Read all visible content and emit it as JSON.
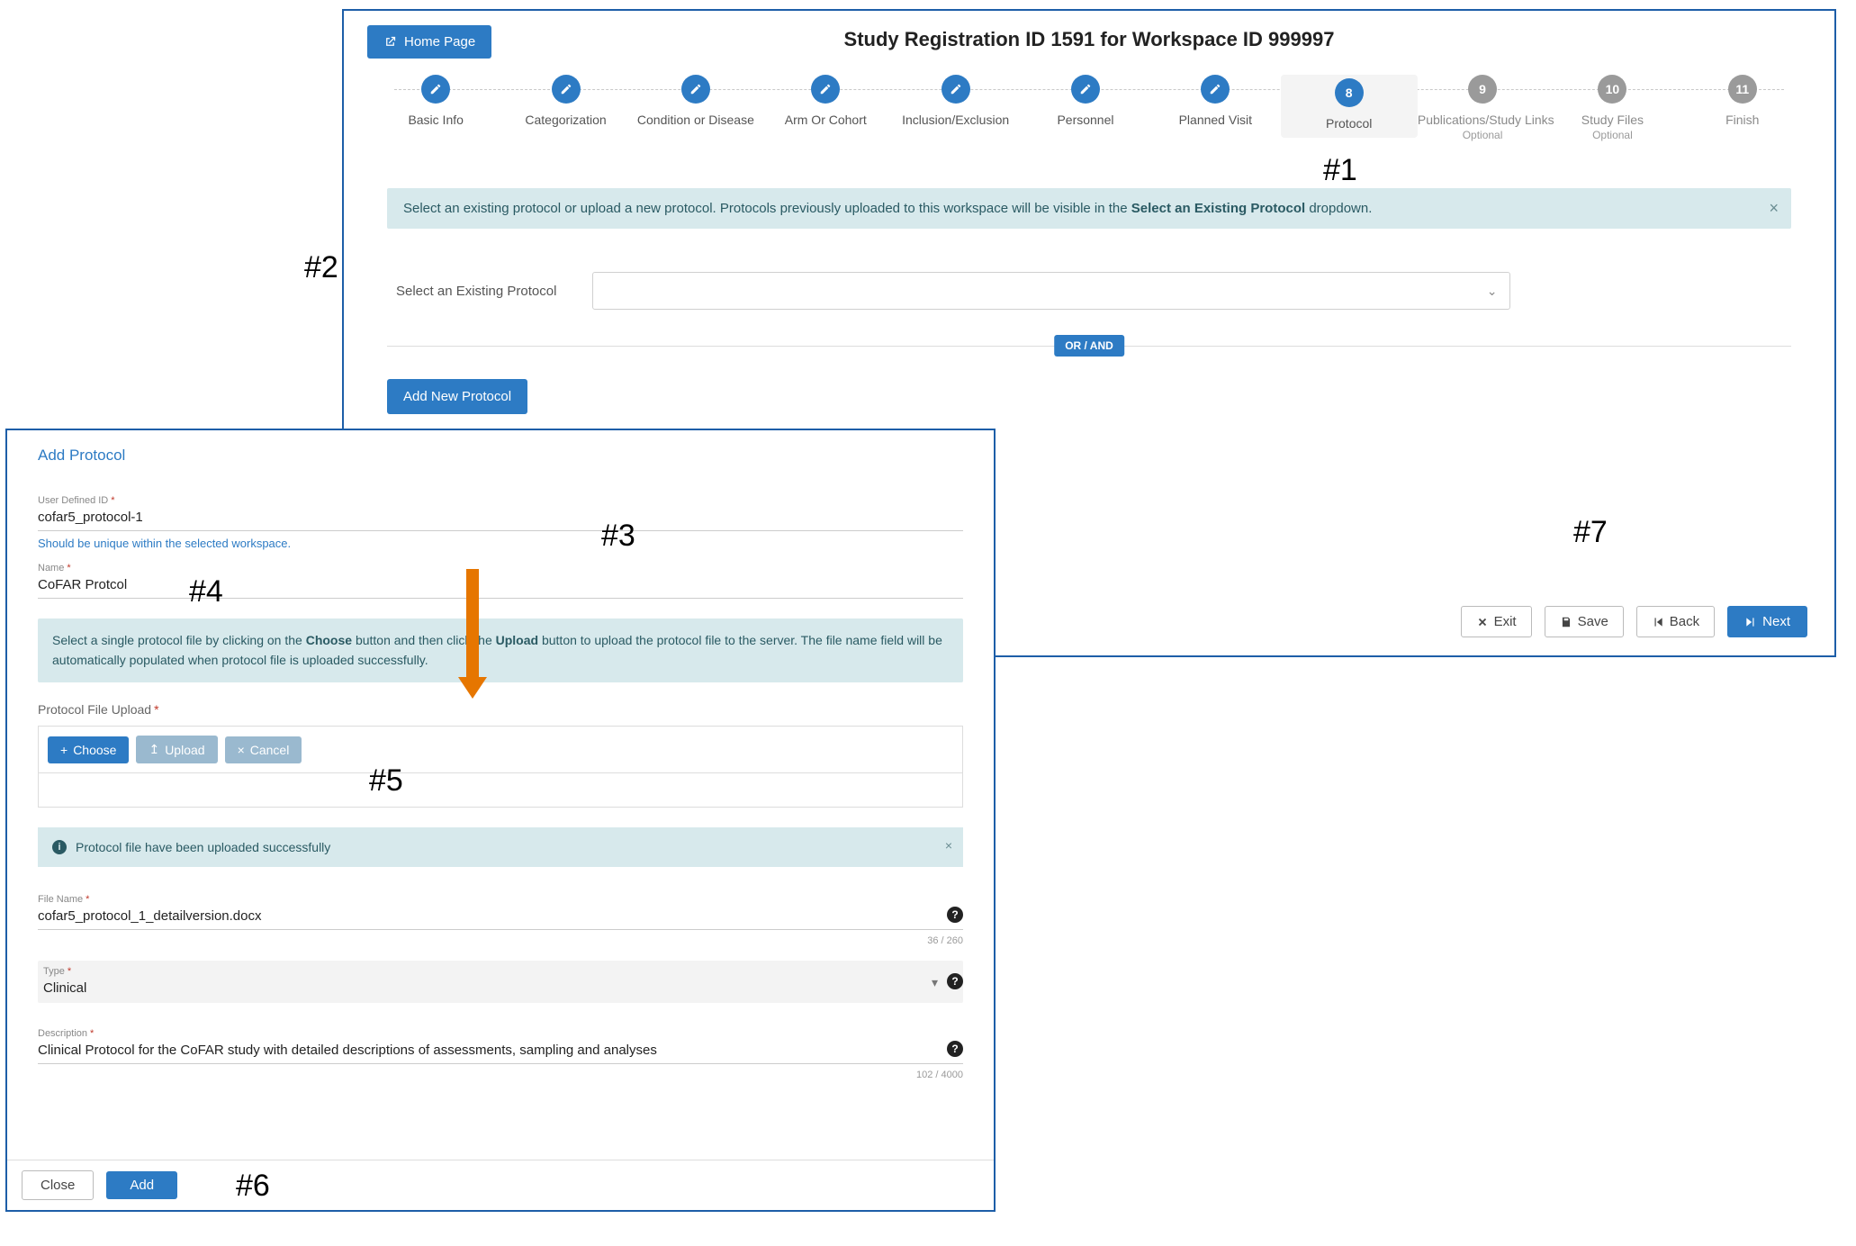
{
  "annotations": {
    "a1": "#1",
    "a2": "#2",
    "a3": "#3",
    "a4": "#4",
    "a5": "#5",
    "a6": "#6",
    "a7": "#7"
  },
  "header": {
    "home_label": "Home Page",
    "title_pre": "Study Registration ID ",
    "reg_id": "1591",
    "title_mid": " for Workspace ID ",
    "ws_id": "999997"
  },
  "stepper": {
    "s1": "Basic Info",
    "s2": "Categorization",
    "s3": "Condition or Disease",
    "s4": "Arm Or Cohort",
    "s5": "Inclusion/Exclusion",
    "s6": "Personnel",
    "s7": "Planned Visit",
    "s8": "Protocol",
    "s8_num": "8",
    "s9": "Publications/Study Links",
    "s9_num": "9",
    "s10": "Study Files",
    "s10_num": "10",
    "s11": "Finish",
    "s11_num": "11",
    "optional": "Optional"
  },
  "main": {
    "info_pre": "Select an existing protocol or upload a new protocol. Protocols previously uploaded to this workspace will be visible in the ",
    "info_bold": "Select an Existing Protocol",
    "info_post": " dropdown.",
    "select_label": "Select an Existing Protocol",
    "divider_label": "OR / AND",
    "add_protocol_label": "Add New Protocol",
    "exit": "Exit",
    "save": "Save",
    "back": "Back",
    "next": "Next"
  },
  "dialog": {
    "title": "Add Protocol",
    "udid_label": "User Defined ID",
    "udid_value": "cofar5_protocol-1",
    "udid_hint": "Should be unique within the selected workspace.",
    "name_label": "Name",
    "name_value": "CoFAR Protcol",
    "instruct_pre": "Select a single protocol file by clicking on the ",
    "instruct_b1": "Choose",
    "instruct_mid": " button and then click the ",
    "instruct_b2": "Upload",
    "instruct_post": " button to upload the protocol file to the server. The file name field will be automatically populated when protocol file is uploaded successfully.",
    "upload_label": "Protocol File Upload",
    "choose": "Choose",
    "upload": "Upload",
    "cancel": "Cancel",
    "success_msg": "Protocol file have been uploaded successfully",
    "filename_label": "File Name",
    "filename_value": "cofar5_protocol_1_detailversion.docx",
    "filename_counter": "36 / 260",
    "type_label": "Type",
    "type_value": "Clinical",
    "desc_label": "Description",
    "desc_value": "Clinical Protocol for the CoFAR study with detailed descriptions of assessments, sampling and analyses",
    "desc_counter": "102 / 4000",
    "close": "Close",
    "add": "Add"
  }
}
